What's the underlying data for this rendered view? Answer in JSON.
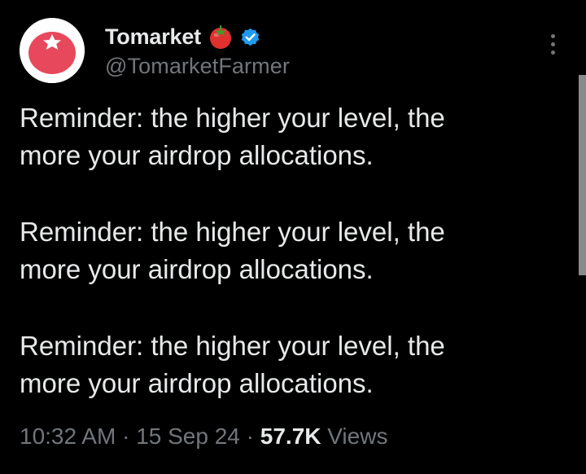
{
  "author": {
    "display_name": "Tomarket",
    "handle": "@TomarketFarmer",
    "avatar_icon": "tomato-logo-icon",
    "name_emoji_icon": "tomato-icon",
    "verified_icon": "verified-badge-icon",
    "verified_color": "#1d9bf0",
    "avatar_color": "#e8485c"
  },
  "tweet": {
    "paragraphs": [
      "Reminder: the higher your level, the\nmore your airdrop allocations.",
      "Reminder: the higher your level, the\nmore your airdrop allocations.",
      "Reminder: the higher your level, the\nmore your airdrop allocations."
    ]
  },
  "meta": {
    "time": "10:32 AM",
    "separator": "·",
    "date": "15 Sep 24",
    "views_count": "57.7K",
    "views_label": "Views"
  },
  "more_menu_icon": "more-vertical-icon",
  "colors": {
    "background": "#000000",
    "primary_text": "#e7e9ea",
    "secondary_text": "#71767b"
  }
}
